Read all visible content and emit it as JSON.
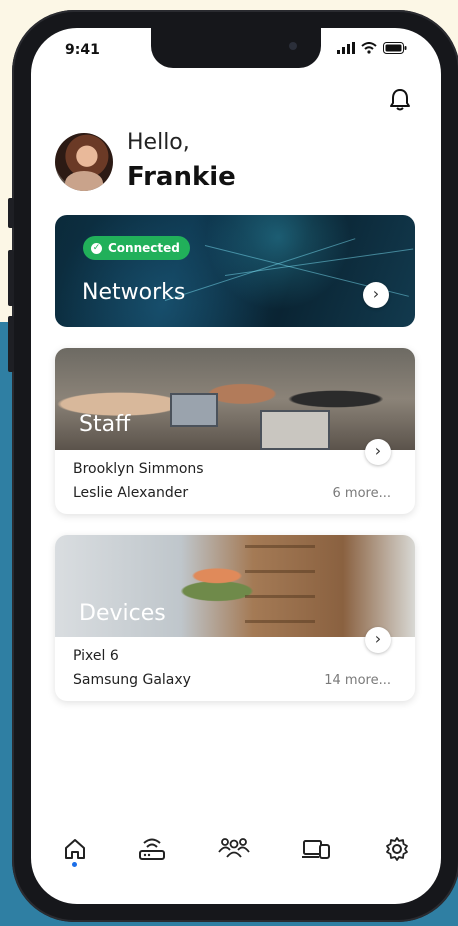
{
  "status": {
    "time": "9:41"
  },
  "greeting": {
    "hello": "Hello,",
    "name": "Frankie"
  },
  "networks": {
    "badge": "Connected",
    "title": "Networks"
  },
  "staff": {
    "title": "Staff",
    "items": [
      "Brooklyn Simmons",
      "Leslie Alexander"
    ],
    "more": "6 more..."
  },
  "devices": {
    "title": "Devices",
    "items": [
      "Pixel 6",
      "Samsung Galaxy"
    ],
    "more": "14 more..."
  },
  "tabs": [
    {
      "icon": "home-icon",
      "active": true
    },
    {
      "icon": "router-icon",
      "active": false
    },
    {
      "icon": "people-icon",
      "active": false
    },
    {
      "icon": "devices-icon",
      "active": false
    },
    {
      "icon": "gear-icon",
      "active": false
    }
  ],
  "colors": {
    "connected": "#21b05a",
    "active_tab_dot": "#1b6ee8"
  }
}
